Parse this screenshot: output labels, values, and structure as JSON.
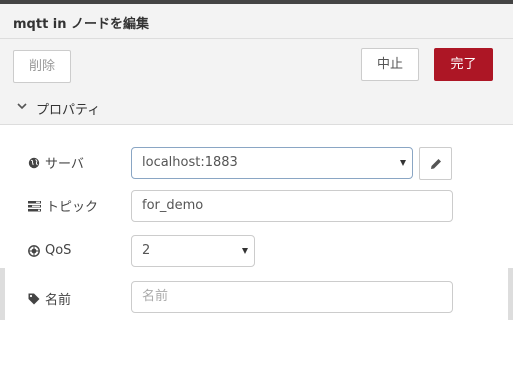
{
  "header": {
    "title": "mqtt in ノードを編集"
  },
  "buttons": {
    "delete_label": "削除",
    "cancel_label": "中止",
    "done_label": "完了"
  },
  "section": {
    "label": "プロパティ"
  },
  "form": {
    "server": {
      "label": "サーバ",
      "value": "localhost:1883",
      "icon": "globe-icon"
    },
    "topic": {
      "label": "トピック",
      "value": "for_demo",
      "icon": "tasks-icon"
    },
    "qos": {
      "label": "QoS",
      "value": "2",
      "icon": "qos-icon"
    },
    "name": {
      "label": "名前",
      "value": "",
      "placeholder": "名前",
      "icon": "tag-icon"
    }
  },
  "colors": {
    "primary": "#ad1625",
    "header_bg": "#f3f3f3",
    "border": "#cccccc",
    "focus_border": "#8aa6c4"
  }
}
